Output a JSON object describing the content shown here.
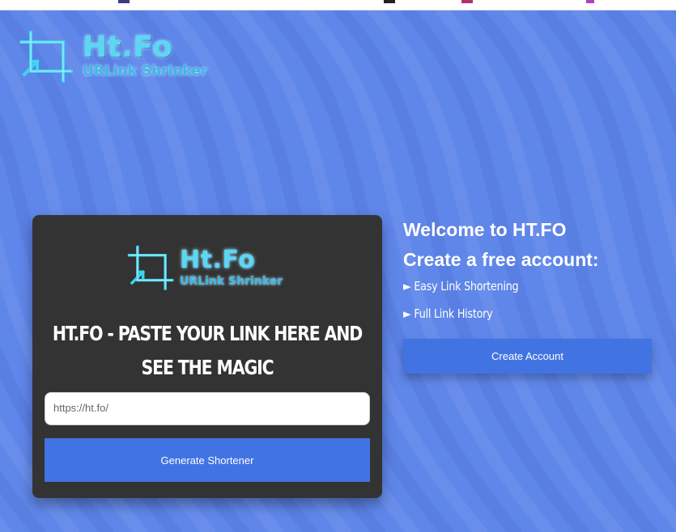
{
  "colors": {
    "page_bg": "#5f86e9",
    "card_bg": "#333333",
    "button_bg": "#4173e3",
    "logo_cyan": "#5ad8f2"
  },
  "logo": {
    "title": "Ht.Fo",
    "subtitle": "URLink Shrinker",
    "icon": "crop-frame-icon"
  },
  "shortener_card": {
    "heading_line1": "HT.FO - PASTE YOUR LINK HERE AND",
    "heading_line2": "SEE THE MAGIC",
    "url_input": {
      "placeholder": "https://ht.fo/",
      "value": ""
    },
    "generate_button": "Generate Shortener"
  },
  "promo": {
    "welcome": "Welcome to HT.FO",
    "cta": "Create a free account:",
    "features": [
      {
        "icon": "play-arrow-icon",
        "bullet": "►",
        "label": "Easy Link Shortening"
      },
      {
        "icon": "play-arrow-icon",
        "bullet": "►",
        "label": "Full Link History"
      }
    ],
    "create_account_button": "Create Account"
  }
}
